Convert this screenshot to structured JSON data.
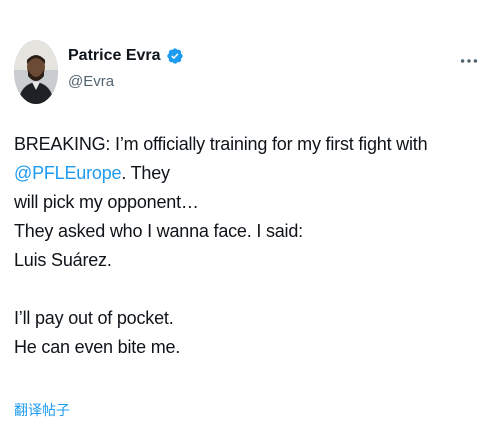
{
  "author": {
    "display_name": "Patrice Evra",
    "handle": "@Evra",
    "verified_color": "#1d9bf0"
  },
  "icons": {
    "verified": "verified-badge-icon",
    "more": "more-options-icon"
  },
  "tweet": {
    "line1_before": "BREAKING: I’m officially training for my first fight with ",
    "line1_mention": "@PFLEurope",
    "line1_after": ". They",
    "line2": "will pick my opponent…",
    "line3": "They asked who I wanna face. I said:",
    "line4": "Luis Suárez.",
    "line5": "I’ll pay out of pocket.",
    "line6": "He can even bite me."
  },
  "translate_label": "翻译帖子",
  "colors": {
    "link": "#1d9bf0",
    "text": "#0f1419",
    "secondary": "#536471"
  }
}
